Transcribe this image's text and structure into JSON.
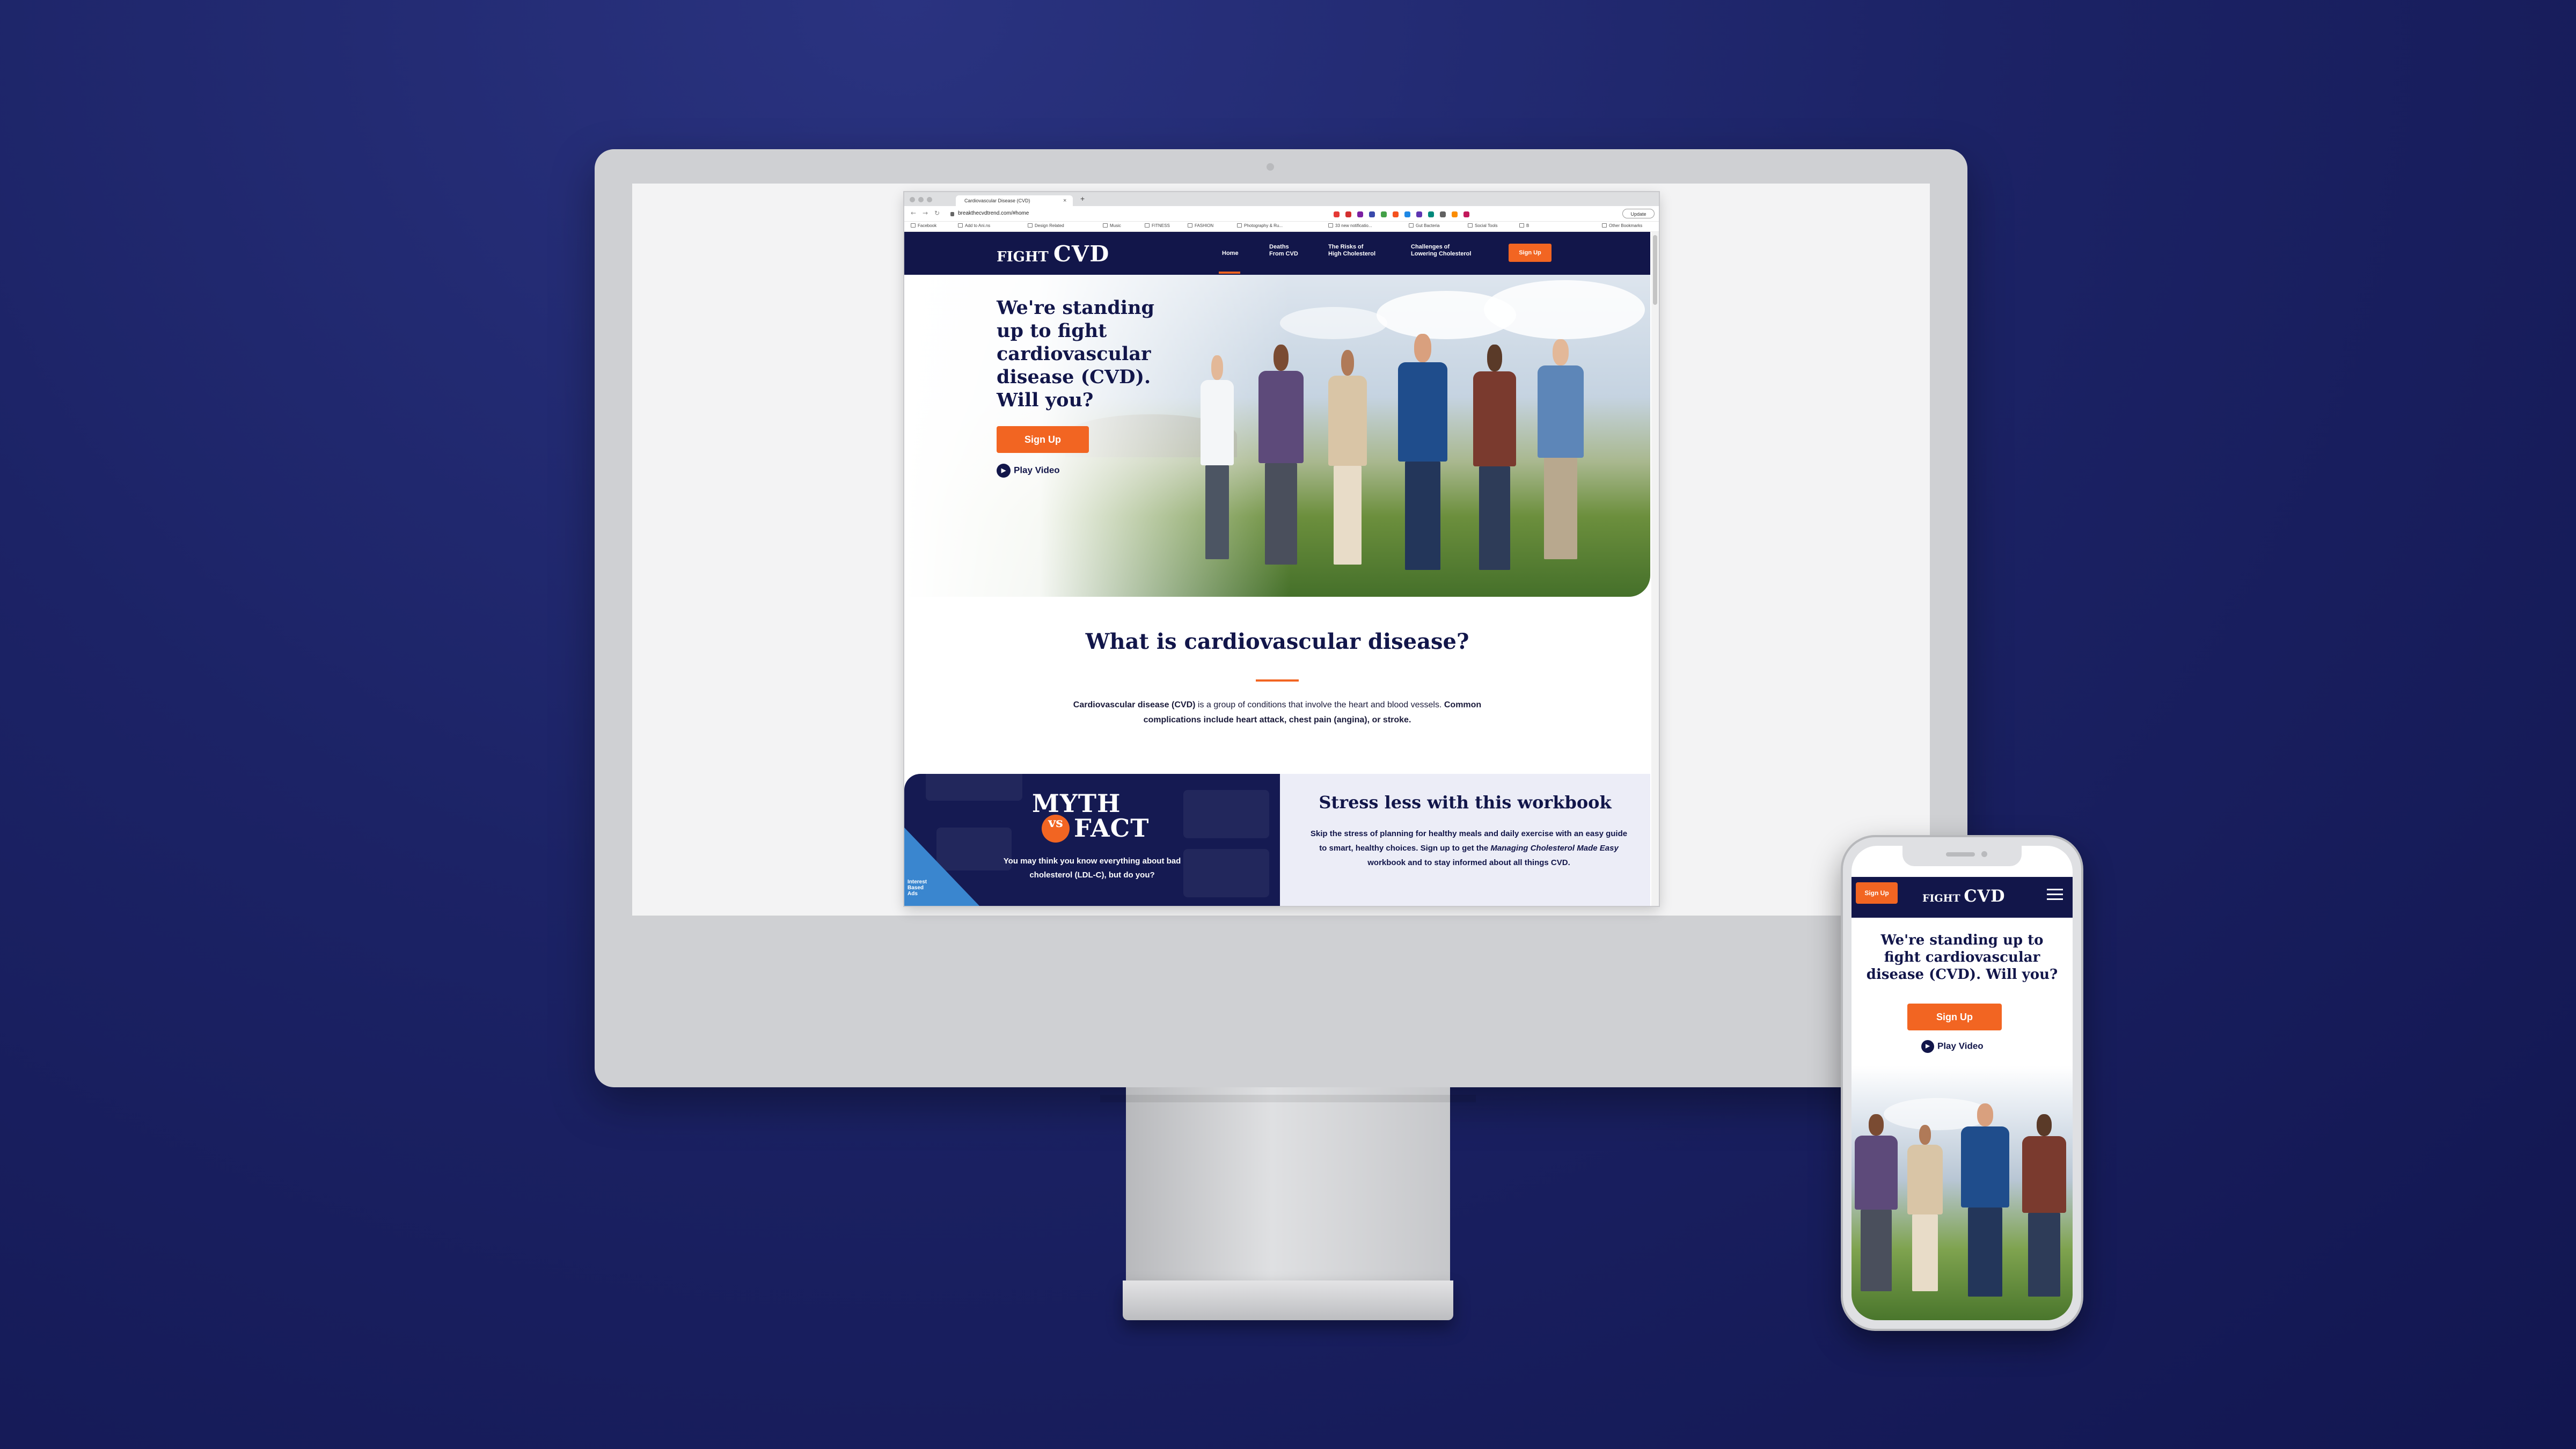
{
  "browser": {
    "tab_title": "Cardiovascular Disease (CVD)",
    "tab_close": "×",
    "new_tab": "+",
    "url": "breakthecvdtrend.com/#home",
    "update_label": "Update",
    "back_glyph": "←",
    "forward_glyph": "→",
    "reload_glyph": "↻",
    "bookmarks": [
      {
        "label": "Facebook"
      },
      {
        "label": "Add to Ani.ns"
      },
      {
        "label": "Design Related"
      },
      {
        "label": "Music"
      },
      {
        "label": "FITNESS"
      },
      {
        "label": "FASHION"
      },
      {
        "label": "Photography & Ru..."
      },
      {
        "label": "33 new notificatio..."
      },
      {
        "label": "Gut Bacteria"
      },
      {
        "label": "Social Tools"
      },
      {
        "label": "B"
      },
      {
        "label": "Other Bookmarks"
      }
    ],
    "extension_colors": [
      "#e53935",
      "#d32f2f",
      "#7b1fa2",
      "#3949ab",
      "#43a047",
      "#f4511e",
      "#1e88e5",
      "#5e35b1",
      "#00897b",
      "#616161",
      "#fb8c00",
      "#c2185b"
    ]
  },
  "site": {
    "logo_small": "FIGHT",
    "logo_big": "CVD",
    "nav": {
      "home": "Home",
      "deaths_line1": "Deaths",
      "deaths_line2": "From CVD",
      "risks_line1": "The Risks of",
      "risks_line2": "High Cholesterol",
      "challenges_line1": "Challenges of",
      "challenges_line2": "Lowering Cholesterol",
      "signup": "Sign Up"
    },
    "hero": {
      "title": "We're standing up to fight cardiovascular disease (CVD). Will you?",
      "signup": "Sign Up",
      "play_icon": "▶",
      "play": "Play Video"
    },
    "what_is": {
      "title": "What is cardiovascular disease?",
      "body_bold_1": "Cardiovascular disease (CVD)",
      "body_1": " is a group of conditions that involve the heart and blood vessels. ",
      "body_bold_2": "Common complications include heart attack, chest pain (angina), or stroke."
    },
    "myth": {
      "myth": "MYTH",
      "vs": "vs",
      "fact": "FACT",
      "body": "You may think you know everything about bad cholesterol (LDL-C), but do you?",
      "corner_line1": "Interest",
      "corner_line2": "Based",
      "corner_line3": "Ads"
    },
    "workbook": {
      "title": "Stress less with this workbook",
      "body_1": "Skip the stress of planning for healthy meals and daily exercise with an easy guide to smart, healthy choices. Sign up to get the ",
      "body_italic": "Managing Cholesterol Made Easy",
      "body_2": " workbook and to stay informed about all things CVD."
    }
  },
  "mobile": {
    "signup": "Sign Up",
    "logo_small": "FIGHT",
    "logo_big": "CVD",
    "title": "We're standing up to fight cardiovascular disease (CVD). Will you?",
    "cta": "Sign Up",
    "play_icon": "▶",
    "play": "Play Video"
  },
  "colors": {
    "navy": "#12164a",
    "orange": "#f26522",
    "background": "#1c2366"
  }
}
